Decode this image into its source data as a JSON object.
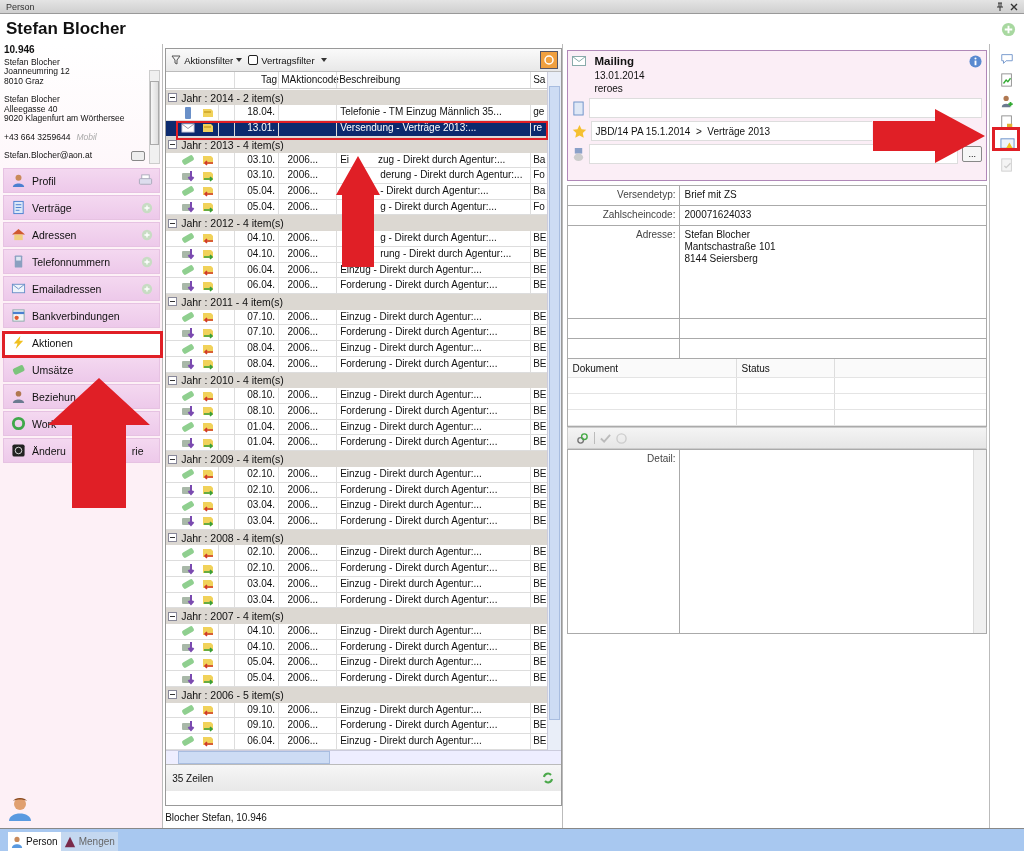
{
  "window": {
    "title": "Person"
  },
  "header": {
    "name": "Stefan Blocher"
  },
  "contact": {
    "number": "10.946",
    "addresses": [
      [
        "Stefan Blocher",
        "Joanneumring 12",
        "8010 Graz"
      ],
      [
        "Stefan Blocher",
        "Alleegasse 40",
        "9020 Klagenfurt am Wörthersee"
      ]
    ],
    "phone": "+43 664 3259644",
    "phone_type": "Mobil",
    "email": "Stefan.Blocher@aon.at"
  },
  "nav": [
    {
      "label": "Profil",
      "kind": "person",
      "selected": false
    },
    {
      "label": "Verträge",
      "kind": "contract",
      "selected": false
    },
    {
      "label": "Adressen",
      "kind": "house",
      "selected": false
    },
    {
      "label": "Telefonnummern",
      "kind": "phone",
      "selected": false
    },
    {
      "label": "Emailadressen",
      "kind": "mail",
      "selected": false
    },
    {
      "label": "Bankverbindungen",
      "kind": "bank",
      "selected": false
    },
    {
      "label": "Aktionen",
      "kind": "lightning",
      "selected": true
    },
    {
      "label": "Umsätze",
      "kind": "money",
      "selected": false
    },
    {
      "label": "Beziehun",
      "kind": "people",
      "selected": false
    },
    {
      "label": "Work",
      "kind": "cycle",
      "selected": false
    },
    {
      "label": "Änderu",
      "tail": "rie",
      "kind": "history",
      "selected": false
    }
  ],
  "toolbar": {
    "filter": "Aktionsfilter",
    "contract_filter": {
      "label": "Vertragsfilter",
      "checked": false
    }
  },
  "table": {
    "columns": [
      "Tag",
      "MAktioncode",
      "Beschreibung",
      "Sa"
    ],
    "groups": [
      {
        "label": "Jahr : 2014 - 2 item(s)",
        "expanded": true,
        "rows": [
          {
            "kind": "phone",
            "tag": "18.04.",
            "desc": "Telefonie - TM Einzug Männlich 35...",
            "sa": "ge",
            "selected": false
          },
          {
            "kind": "mail",
            "tag": "13.01.",
            "desc": "Versendung - Verträge 2013:...",
            "sa": "re",
            "selected": true
          }
        ]
      },
      {
        "label": "Jahr : 2013 - 4 item(s)",
        "expanded": true,
        "rows": [
          {
            "kind": "einzug",
            "tag": "03.10.",
            "code": "2006...",
            "lead": "Ei",
            "gap": true,
            "desc": "zug - Direkt durch Agentur:...",
            "sa": "Ba",
            "selected": false
          },
          {
            "kind": "forderung",
            "tag": "03.10.",
            "code": "2006...",
            "gap": true,
            "desc": "derung - Direkt durch Agentur:...",
            "sa": "Fo",
            "selected": false
          },
          {
            "kind": "einzug",
            "tag": "05.04.",
            "code": "2006...",
            "gap": true,
            "desc": "- Direkt durch Agentur:...",
            "sa": "Ba",
            "selected": false
          },
          {
            "kind": "forderung",
            "tag": "05.04.",
            "code": "2006...",
            "gap": true,
            "desc": "g - Direkt durch Agentur:...",
            "sa": "Fo",
            "selected": false
          }
        ]
      },
      {
        "label": "Jahr : 2012 - 4 item(s)",
        "expanded": true,
        "rows": [
          {
            "kind": "einzug",
            "tag": "04.10.",
            "code": "2006...",
            "gap": true,
            "desc": "g - Direkt durch Agentur:...",
            "sa": "BE",
            "selected": false
          },
          {
            "kind": "forderung",
            "tag": "04.10.",
            "code": "2006...",
            "gap": true,
            "desc": "rung - Direkt durch Agentur:...",
            "sa": "BE",
            "selected": false
          },
          {
            "kind": "einzug",
            "tag": "06.04.",
            "code": "2006...",
            "desc": "Einzug - Direkt durch Agentur:...",
            "sa": "BE",
            "selected": false
          },
          {
            "kind": "forderung",
            "tag": "06.04.",
            "code": "2006...",
            "desc": "Forderung - Direkt durch Agentur:...",
            "sa": "BE",
            "selected": false
          }
        ]
      },
      {
        "label": "Jahr : 2011 - 4 item(s)",
        "expanded": true,
        "rows": [
          {
            "kind": "einzug",
            "tag": "07.10.",
            "code": "2006...",
            "desc": "Einzug - Direkt durch Agentur:...",
            "sa": "BE",
            "selected": false
          },
          {
            "kind": "forderung",
            "tag": "07.10.",
            "code": "2006...",
            "desc": "Forderung - Direkt durch Agentur:...",
            "sa": "BE",
            "selected": false
          },
          {
            "kind": "einzug",
            "tag": "08.04.",
            "code": "2006...",
            "desc": "Einzug - Direkt durch Agentur:...",
            "sa": "BE",
            "selected": false
          },
          {
            "kind": "forderung",
            "tag": "08.04.",
            "code": "2006...",
            "desc": "Forderung - Direkt durch Agentur:...",
            "sa": "BE",
            "selected": false
          }
        ]
      },
      {
        "label": "Jahr : 2010 - 4 item(s)",
        "expanded": true,
        "rows": [
          {
            "kind": "einzug",
            "tag": "08.10.",
            "code": "2006...",
            "desc": "Einzug - Direkt durch Agentur:...",
            "sa": "BE",
            "selected": false
          },
          {
            "kind": "forderung",
            "tag": "08.10.",
            "code": "2006...",
            "desc": "Forderung - Direkt durch Agentur:...",
            "sa": "BE",
            "selected": false
          },
          {
            "kind": "einzug",
            "tag": "01.04.",
            "code": "2006...",
            "desc": "Einzug - Direkt durch Agentur:...",
            "sa": "BE",
            "selected": false
          },
          {
            "kind": "forderung",
            "tag": "01.04.",
            "code": "2006...",
            "desc": "Forderung - Direkt durch Agentur:...",
            "sa": "BE",
            "selected": false
          }
        ]
      },
      {
        "label": "Jahr : 2009 - 4 item(s)",
        "expanded": true,
        "rows": [
          {
            "kind": "einzug",
            "tag": "02.10.",
            "code": "2006...",
            "desc": "Einzug - Direkt durch Agentur:...",
            "sa": "BE",
            "selected": false
          },
          {
            "kind": "forderung",
            "tag": "02.10.",
            "code": "2006...",
            "desc": "Forderung - Direkt durch Agentur:...",
            "sa": "BE",
            "selected": false
          },
          {
            "kind": "einzug",
            "tag": "03.04.",
            "code": "2006...",
            "desc": "Einzug - Direkt durch Agentur:...",
            "sa": "BE",
            "selected": false
          },
          {
            "kind": "forderung",
            "tag": "03.04.",
            "code": "2006...",
            "desc": "Forderung - Direkt durch Agentur:...",
            "sa": "BE",
            "selected": false
          }
        ]
      },
      {
        "label": "Jahr : 2008 - 4 item(s)",
        "expanded": true,
        "rows": [
          {
            "kind": "einzug",
            "tag": "02.10.",
            "code": "2006...",
            "desc": "Einzug - Direkt durch Agentur:...",
            "sa": "BE",
            "selected": false
          },
          {
            "kind": "forderung",
            "tag": "02.10.",
            "code": "2006...",
            "desc": "Forderung - Direkt durch Agentur:...",
            "sa": "BE",
            "selected": false
          },
          {
            "kind": "einzug",
            "tag": "03.04.",
            "code": "2006...",
            "desc": "Einzug - Direkt durch Agentur:...",
            "sa": "BE",
            "selected": false
          },
          {
            "kind": "forderung",
            "tag": "03.04.",
            "code": "2006...",
            "desc": "Forderung - Direkt durch Agentur:...",
            "sa": "BE",
            "selected": false
          }
        ]
      },
      {
        "label": "Jahr : 2007 - 4 item(s)",
        "expanded": true,
        "rows": [
          {
            "kind": "einzug",
            "tag": "04.10.",
            "code": "2006...",
            "desc": "Einzug - Direkt durch Agentur:...",
            "sa": "BE",
            "selected": false
          },
          {
            "kind": "forderung",
            "tag": "04.10.",
            "code": "2006...",
            "desc": "Forderung - Direkt durch Agentur:...",
            "sa": "BE",
            "selected": false
          },
          {
            "kind": "einzug",
            "tag": "05.04.",
            "code": "2006...",
            "desc": "Einzug - Direkt durch Agentur:...",
            "sa": "BE",
            "selected": false
          },
          {
            "kind": "forderung",
            "tag": "05.04.",
            "code": "2006...",
            "desc": "Forderung - Direkt durch Agentur:...",
            "sa": "BE",
            "selected": false
          }
        ]
      },
      {
        "label": "Jahr : 2006 - 5 item(s)",
        "expanded": true,
        "rows": [
          {
            "kind": "einzug",
            "tag": "09.10.",
            "code": "2006...",
            "desc": "Einzug - Direkt durch Agentur:...",
            "sa": "BE",
            "selected": false
          },
          {
            "kind": "forderung",
            "tag": "09.10.",
            "code": "2006...",
            "desc": "Forderung - Direkt durch Agentur:...",
            "sa": "BE",
            "selected": false
          },
          {
            "kind": "einzug",
            "tag": "06.04.",
            "code": "2006...",
            "desc": "Einzug - Direkt durch Agentur:...",
            "sa": "BE",
            "selected": false
          }
        ]
      }
    ]
  },
  "table_footer": {
    "count": "35 Zeilen"
  },
  "status_text": "Blocher Stefan, 10.946",
  "mailing": {
    "title": "Mailing",
    "date": "13.01.2014",
    "user": "reroes",
    "campaign": "JBD/14 PA 15.1.2014  >  Verträge 2013",
    "browse_button": "..."
  },
  "form": [
    {
      "label": "Versendetyp:",
      "value": [
        "Brief mit ZS"
      ]
    },
    {
      "label": "Zahlscheincode:",
      "value": [
        "200071624033"
      ]
    },
    {
      "label": "Adresse:",
      "value": [
        "Stefan Blocher",
        "Mantschastraße 101",
        "8144 Seiersberg"
      ],
      "kind": "tall"
    }
  ],
  "documents": {
    "columns": [
      "Dokument",
      "Status"
    ]
  },
  "detail": {
    "label": "Detail:"
  },
  "bottom_tabs": [
    {
      "label": "Person",
      "selected": true
    },
    {
      "label": "Mengen",
      "selected": false
    }
  ]
}
